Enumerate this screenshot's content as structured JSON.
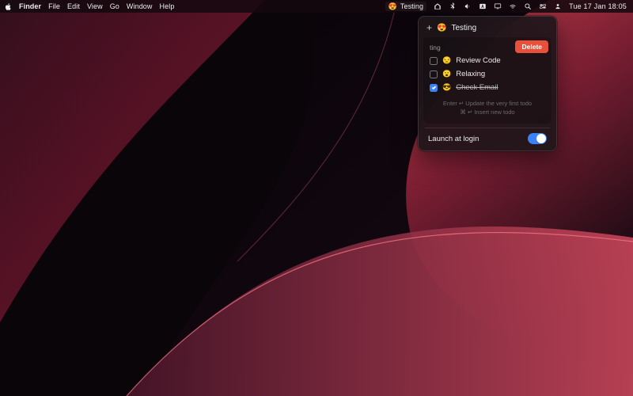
{
  "menubar": {
    "app": "Finder",
    "menus": [
      "File",
      "Edit",
      "View",
      "Go",
      "Window",
      "Help"
    ],
    "status_emoji": "😍",
    "status_label": "Testing",
    "clock": "Tue 17 Jan  18:05"
  },
  "panel": {
    "input_placeholder": "Testing",
    "header_emoji": "😍",
    "delete_label": "Delete",
    "category_label": "ting",
    "todos": [
      {
        "emoji": "😒",
        "label": "Review Code",
        "done": false
      },
      {
        "emoji": "😮",
        "label": "Relaxing",
        "done": false
      },
      {
        "emoji": "😎",
        "label": "Check Email",
        "done": true
      }
    ],
    "hint1": "Enter ↵ Update the very first todo",
    "hint2": "⌘ ↵ Insert new todo",
    "launch_label": "Launch at login",
    "launch_on": true
  },
  "colors": {
    "accent": "#3a82f7",
    "delete": "#e7513c"
  }
}
